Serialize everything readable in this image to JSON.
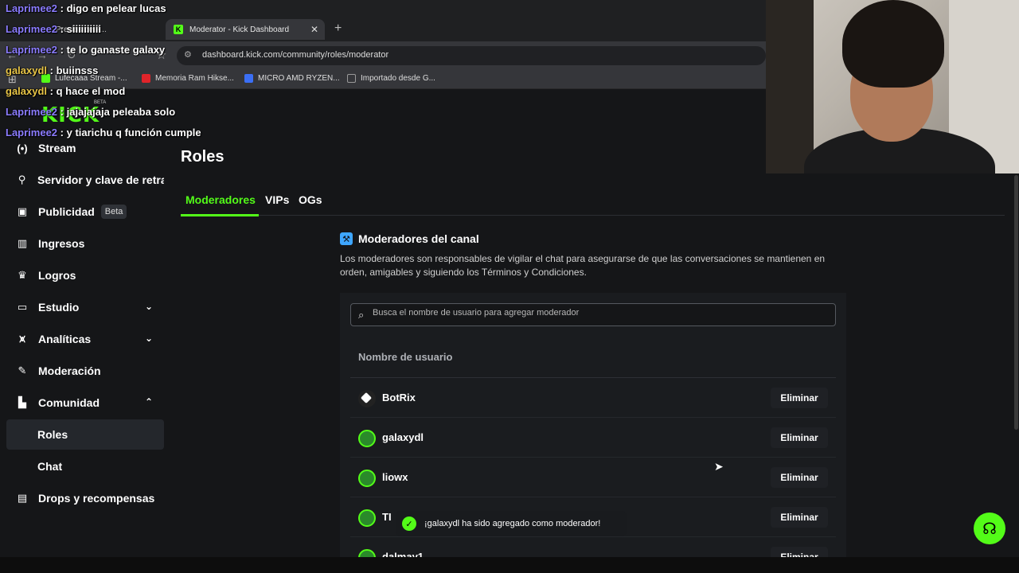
{
  "browser": {
    "tabs": [
      {
        "label": "Precios de P..."
      },
      {
        "label": "Moderator - Kick Dashboard"
      }
    ],
    "tab_close": "✕",
    "new_tab": "+",
    "url": "dashboard.kick.com/community/roles/moderator",
    "bookmarks": [
      {
        "label": "Lufecaaa Stream -...",
        "color": "#53fc18"
      },
      {
        "label": "Memoria Ram Hikse...",
        "color": "#e0242a"
      },
      {
        "label": "MICRO AMD RYZEN...",
        "color": "#3b6ff5"
      },
      {
        "label": "Importado desde G...",
        "color": "#999999"
      }
    ]
  },
  "brand": {
    "logo": "KICK",
    "beta": "BETA",
    "accent": "#53fc18"
  },
  "sidebar": {
    "items": [
      {
        "label": "Stream",
        "icon": "(•)"
      },
      {
        "label": "Servidor y clave de retran",
        "icon": "⚲"
      },
      {
        "label": "Publicidad",
        "badge": "Beta",
        "icon": "▣"
      },
      {
        "label": "Ingresos",
        "icon": "▥"
      },
      {
        "label": "Logros",
        "icon": "♛"
      },
      {
        "label": "Estudio",
        "icon": "▭",
        "chevron": "⌄"
      },
      {
        "label": "Analíticas",
        "icon": "⩙",
        "chevron": "⌄"
      },
      {
        "label": "Moderación",
        "icon": "✎"
      },
      {
        "label": "Comunidad",
        "icon": "▙",
        "chevron": "⌃"
      },
      {
        "label": "Roles"
      },
      {
        "label": "Chat"
      },
      {
        "label": "Drops y recompensas",
        "icon": "▤"
      }
    ]
  },
  "main": {
    "title": "Roles",
    "tabs": [
      "Moderadores",
      "VIPs",
      "OGs"
    ],
    "section_title": "Moderadores del canal",
    "section_desc": "Los moderadores son responsables de vigilar el chat para asegurarse de que las conversaciones se mantienen en orden, amigables y siguiendo los Términos y Condiciones.",
    "search_placeholder": "Busca el nombre de usuario para agregar moderador",
    "column_header": "Nombre de usuario",
    "delete_label": "Eliminar",
    "moderators": [
      "BotRix",
      "galaxydl",
      "liowx",
      "TI",
      "dalmay1"
    ]
  },
  "toast": {
    "message": "¡galaxydl ha sido agregado como moderador!"
  },
  "chat": [
    {
      "user": "Laprimee2",
      "msg": "digo en pelear lucas"
    },
    {
      "user": "Laprimee2",
      "msg": "siiiiiiiiii"
    },
    {
      "user": "Laprimee2",
      "msg": "te lo ganaste galaxy"
    },
    {
      "user": "galaxydl",
      "msg": "buiinsss"
    },
    {
      "user": "galaxydl",
      "msg": "q hace el mod"
    },
    {
      "user": "Laprimee2",
      "msg": "jajajajaja peleaba solo"
    },
    {
      "user": "Laprimee2",
      "msg": "y tiarichu q función cumple"
    }
  ]
}
